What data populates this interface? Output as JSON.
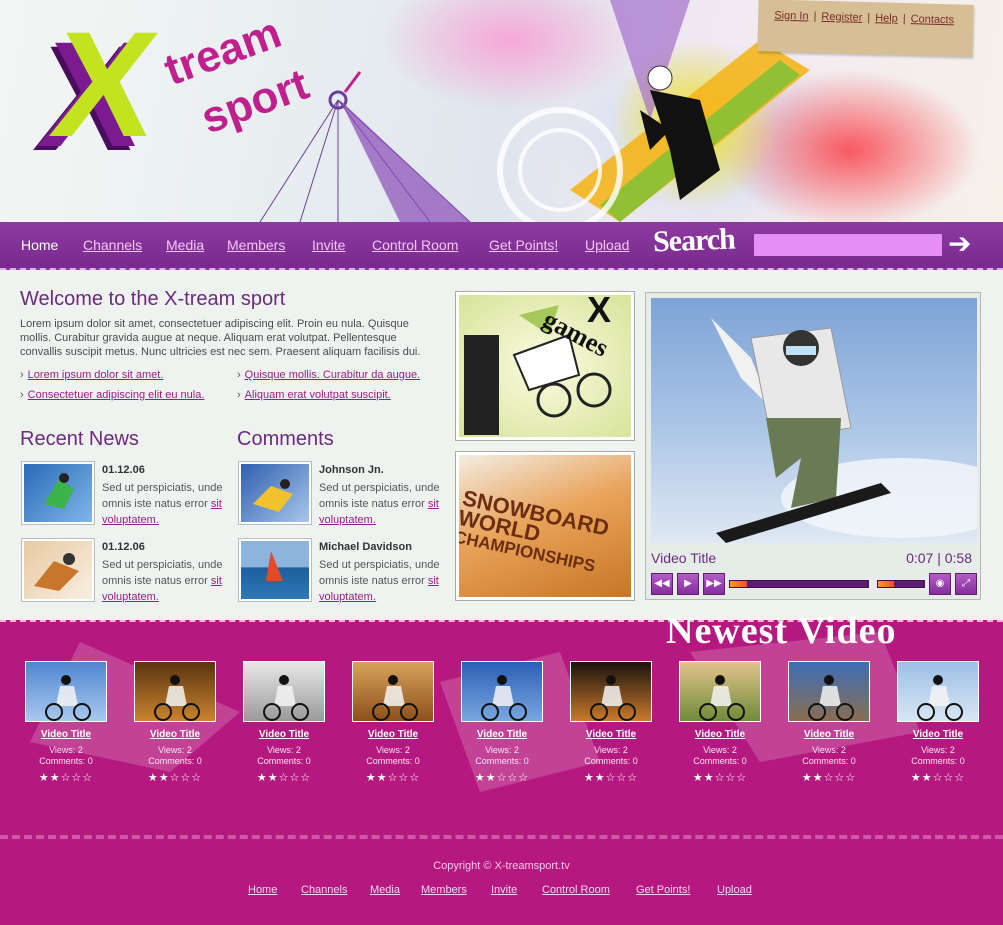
{
  "header": {
    "logo_x": "X",
    "logo_word1": "tream",
    "logo_word2": "sport",
    "toplinks": [
      "Sign In",
      "Register",
      "Help",
      "Contacts"
    ]
  },
  "nav": {
    "items": [
      "Home",
      "Channels",
      "Media",
      "Members",
      "Invite",
      "Control Room",
      "Get Points!",
      "Upload"
    ],
    "search_label": "Search",
    "search_placeholder": ""
  },
  "welcome": {
    "title": "Welcome to the X-tream sport",
    "text": "Lorem ipsum dolor sit amet, consectetuer adipiscing elit. Proin eu nula. Quisque mollis. Curabitur gravida augue at neque. Aliquam erat volutpat. Pellentesque convallis suscipit metus. Nunc ultricies est nec sem. Praesent aliquam facilisis dui.",
    "links": [
      "Lorem ipsum dolor sit amet.",
      "Quisque mollis. Curabitur da augue.",
      "Consectetuer adipiscing elit eu nula.",
      "Aliquam erat volutpat suscipit."
    ]
  },
  "recent_news": {
    "title": "Recent News",
    "items": [
      {
        "date": "01.12.06",
        "text": "Sed ut perspiciatis, unde omnis iste natus error ",
        "link": "sit voluptatem."
      },
      {
        "date": "01.12.06",
        "text": "Sed ut perspiciatis, unde omnis iste natus error ",
        "link": "sit voluptatem."
      }
    ]
  },
  "comments": {
    "title": "Comments",
    "items": [
      {
        "name": "Johnson Jn.",
        "text": "Sed ut perspiciatis, unde omnis iste natus error ",
        "link": "sit voluptatem."
      },
      {
        "name": "Michael Davidson",
        "text": "Sed ut perspiciatis, unde omnis iste natus error ",
        "link": "sit voluptatem."
      }
    ]
  },
  "promos": {
    "games": "games",
    "games_x": "X",
    "snowboard_line1": "SNOWBOARD",
    "snowboard_line2": "WORLD",
    "snowboard_line3": "CHAMPIONSHIPS"
  },
  "player": {
    "title": "Video Title",
    "current_time": "0:07",
    "separator": "|",
    "total_time": "0:58",
    "progress": 0.12,
    "volume": 0.35
  },
  "newest": {
    "title": "Newest Video",
    "videos": [
      {
        "title": "Video Title",
        "views": "Views: 2",
        "comments": "Comments: 0",
        "stars": "★★☆☆☆"
      },
      {
        "title": "Video Title",
        "views": "Views: 2",
        "comments": "Comments: 0",
        "stars": "★★☆☆☆"
      },
      {
        "title": "Video Title",
        "views": "Views: 2",
        "comments": "Comments: 0",
        "stars": "★★☆☆☆"
      },
      {
        "title": "Video Title",
        "views": "Views: 2",
        "comments": "Comments: 0",
        "stars": "★★☆☆☆"
      },
      {
        "title": "Video Title",
        "views": "Views: 2",
        "comments": "Comments: 0",
        "stars": "★★☆☆☆"
      },
      {
        "title": "Video Title",
        "views": "Views: 2",
        "comments": "Comments: 0",
        "stars": "★★☆☆☆"
      },
      {
        "title": "Video Title",
        "views": "Views: 2",
        "comments": "Comments: 0",
        "stars": "★★☆☆☆"
      },
      {
        "title": "Video Title",
        "views": "Views: 2",
        "comments": "Comments: 0",
        "stars": "★★☆☆☆"
      },
      {
        "title": "Video Title",
        "views": "Views: 2",
        "comments": "Comments: 0",
        "stars": "★★☆☆☆"
      }
    ]
  },
  "footer": {
    "copyright": "Copyright © X-treamsport.tv",
    "links": [
      "Home",
      "Channels",
      "Media",
      "Members",
      "Invite",
      "Control Room",
      "Get Points!",
      "Upload"
    ]
  },
  "colors": {
    "brand_purple": "#7a2a8f",
    "brand_magenta": "#b5197f",
    "accent_lime": "#c3e21f",
    "link_magenta": "#9b1c86"
  }
}
